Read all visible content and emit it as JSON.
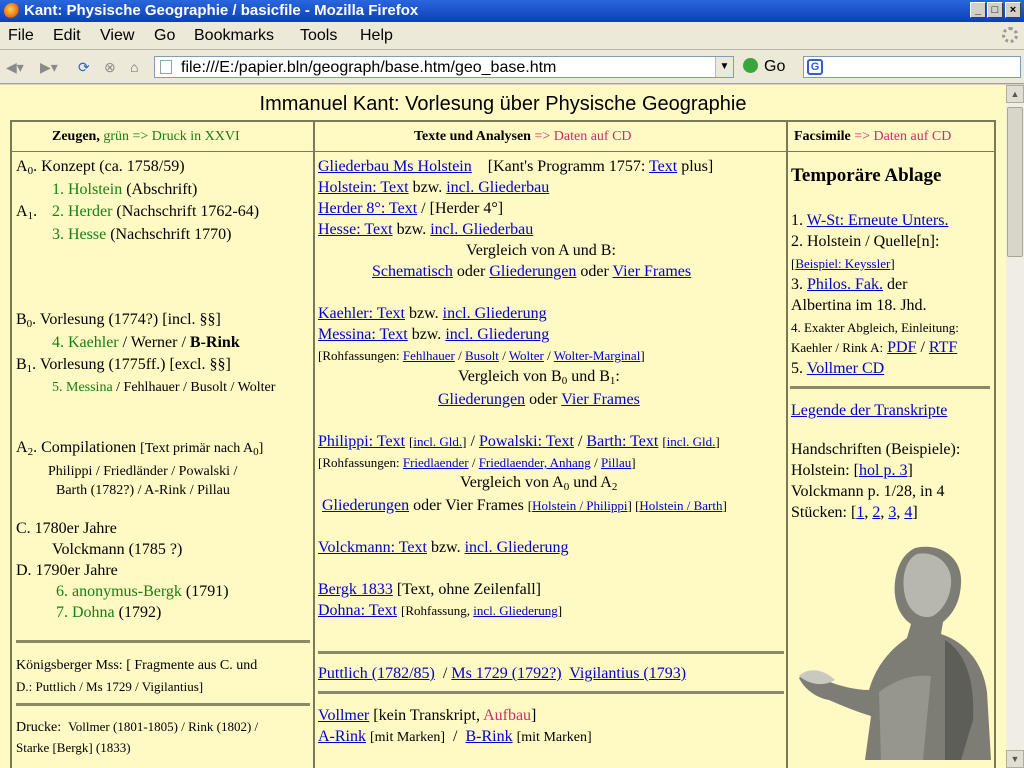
{
  "window": {
    "title": "Kant: Physische Geographie / basicfile - Mozilla Firefox",
    "buttons": [
      "_",
      "□",
      "×"
    ]
  },
  "menu": [
    "File",
    "Edit",
    "View",
    "Go",
    "Bookmarks",
    "Tools",
    "Help"
  ],
  "nav": {
    "url": "file:///E:/papier.bln/geograph/base.htm/geo_base.htm",
    "go_label": "Go",
    "search_icon_letter": "G"
  },
  "page": {
    "title": "Immanuel Kant: Vorlesung über Physische Geographie",
    "headers": {
      "col1_main": "Zeugen,",
      "col1_note": "grün => Druck in XXVI",
      "col2_main": "Texte und Analysen",
      "col2_note": "=> Daten auf CD",
      "col3_main": "Facsimile",
      "col3_note": "=> Daten auf CD"
    },
    "col1": {
      "a0_label": "A",
      "a0_sub": "0",
      "a0_text": ". Konzept (ca. 1758/59)",
      "holstein_num": "1.",
      "holstein": "Holstein",
      "holstein_note": "(Abschrift)",
      "a1_label": "A",
      "a1_sub": "1",
      "herder_num": "2.",
      "herder": "Herder",
      "herder_note": "(Nachschrift 1762-64)",
      "hesse_num": "3.",
      "hesse": "Hesse",
      "hesse_note": "(Nachschrift 1770)",
      "b0_label": "B",
      "b0_sub": "0",
      "b0_text": ". Vorlesung (1774?) [incl. §§]",
      "kaehler_num": "4.",
      "kaehler": "Kaehler",
      "kaehler_rest": "/ Werner /",
      "brink": "B-Rink",
      "b1_label": "B",
      "b1_sub": "1",
      "b1_text": ". Vorlesung (1775ff.) [excl. §§]",
      "messina_num": "5.",
      "messina": "Messina",
      "messina_rest": "/ Fehlhauer / Busolt / Wolter",
      "a2_label": "A",
      "a2_sub": "2",
      "a2_text": ". Compilationen",
      "a2_note": "[Text primär nach A",
      "a2_note_sub": "0",
      "a2_note_end": "]",
      "a2_line2": "Philippi / Friedländer / Powalski /",
      "a2_line3": "Barth (1782?) / A-Rink / Pillau",
      "c_text": "C. 1780er Jahre",
      "volckmann": "Volckmann (1785 ?)",
      "d_text": "D. 1790er Jahre",
      "anon_num": "6.",
      "anon": "anonymus-Bergk",
      "anon_note": "(1791)",
      "dohna_num": "7.",
      "dohna": "Dohna",
      "dohna_note": "(1792)",
      "kb_label": "Königsberger Mss:",
      "kb_note": "[ Fragmente aus C. und",
      "kb_line2": "D.:  Puttlich / Ms 1729 / Vigilantius]",
      "drucke_label": "Drucke:",
      "drucke_note": "Vollmer (1801-1805) / Rink (1802) /",
      "drucke_line2": "Starke [Bergk] (1833)"
    },
    "col2": {
      "gliederbau_holstein": "Gliederbau Ms Holstein",
      "programm_pre": "[Kant's Programm 1757:",
      "programm_link": "Text",
      "programm_post": "plus]",
      "holstein_text": "Holstein: Text",
      "bzw": "bzw.",
      "incl_gliederbau": "incl. Gliederbau",
      "herder_text": "Herder 8°: Text",
      "herder_post": "/  [Herder 4°]",
      "hesse_text": "Hesse: Text",
      "incl_gliederbau2": "incl. Gliederbau",
      "vergleich_ab": "Vergleich von A und B:",
      "schematisch": "Schematisch",
      "oder": "oder",
      "gliederungen": "Gliederungen",
      "vier_frames": "Vier Frames",
      "kaehler_text": "Kaehler: Text",
      "incl_gliederung": "incl. Gliederung",
      "messina_text": "Messina: Text",
      "rohfassungen": "[Rohfassungen:",
      "fehlhauer": "Fehlhauer",
      "busolt": "Busolt",
      "wolter": "Wolter",
      "wolter_marginal": "Wolter-Marginal",
      "close_br": "]",
      "vergleich_b": "Vergleich von B",
      "und_b": " und B",
      "sub0": "0",
      "sub1": "1",
      "colon": ":",
      "philippi_text": "Philippi: Text",
      "incl_gld": "incl. Gld.",
      "powalski_text": "Powalski: Text",
      "barth_text": "Barth: Text",
      "friedlaender": "Friedlaender",
      "friedlaender_anhang": "Friedlaender, Anhang",
      "pillau": "Pillau",
      "vergleich_a": "Vergleich von A",
      "und_a": " und A",
      "sub2": "2",
      "vier_frames_plain": "oder Vier Frames",
      "holstein_philippi": "Holstein / Philippi",
      "holstein_barth": "Holstein / Barth",
      "volckmann_text": "Volckmann: Text",
      "bergk": "Bergk 1833",
      "bergk_note": "[Text, ohne Zeilenfall]",
      "dohna_text": "Dohna: Text",
      "rohfassung": "[Rohfassung,",
      "puttlich": "Puttlich (1782/85)",
      "ms1729": "Ms 1729 (1792?)",
      "vigilantius": "Vigilantius (1793)",
      "vollmer": "Vollmer",
      "kein_transkript": "[kein Transkript,",
      "aufbau": "Aufbau",
      "arink": "A-Rink",
      "mit_marken": "[mit Marken]",
      "brink": "B-Rink",
      "slash": "/"
    },
    "col3": {
      "heading": "Temporäre Ablage",
      "i1_num": "1.",
      "i1_link": "W-St: Erneute Unters.",
      "i2": "2. Holstein / Quelle[n]:",
      "i2_link": "Beispiel: Keyssler",
      "i3_num": "3.",
      "i3_link": "Philos. Fak.",
      "i3_post": "der",
      "i3_line2": "Albertina im 18. Jhd.",
      "i4": "4. Exakter Abgleich, Einleitung:",
      "i4_line2": "Kaehler / Rink A:",
      "pdf": "PDF",
      "rtf": "RTF",
      "i5_num": "5.",
      "i5_link": "Vollmer  CD",
      "legende": "Legende der Transkripte",
      "hs": "Handschriften (Beispiele):",
      "hs_holstein": "Holstein: [",
      "hol_p3": "hol  p. 3",
      "volck": "Volckmann p. 1/28, in 4",
      "stuecken": "Stücken: [",
      "n1": "1",
      "n2": "2",
      "n3": "3",
      "n4": "4"
    }
  }
}
